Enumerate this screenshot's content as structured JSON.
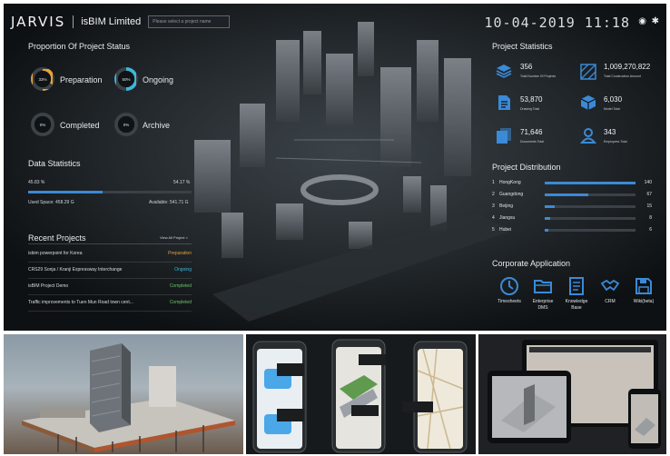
{
  "header": {
    "logo": "JARVIS",
    "company": "isBIM Limited",
    "search_placeholder": "Please select a project name",
    "clock": "10-04-2019 11:18"
  },
  "project_status": {
    "title": "Proportion Of Project Status",
    "items": [
      {
        "pct": "33%",
        "label": "Preparation",
        "value": 33,
        "color": "#e8a23a"
      },
      {
        "pct": "50%",
        "label": "Ongoing",
        "value": 50,
        "color": "#3fb6d8"
      },
      {
        "pct": "0%",
        "label": "Completed",
        "value": 0,
        "color": "#6ec36b"
      },
      {
        "pct": "0%",
        "label": "Archive",
        "value": 0,
        "color": "#9aa3ab"
      }
    ]
  },
  "data_statistics": {
    "title": "Data Statistics",
    "used_pct": "45.83 %",
    "available_pct": "54.17 %",
    "used_fraction": 0.4583,
    "used_space": "Used Space: 458.29 G",
    "available": "Available: 541.71 G"
  },
  "recent_projects": {
    "title": "Recent Projects",
    "view_all": "View All Project >",
    "rows": [
      {
        "name": "isbim powerpoint for Korea",
        "status": "Preparation",
        "color": "#e8a23a"
      },
      {
        "name": "CRS29 Sonja / Kranji Expressway Interchange",
        "status": "Ongoing",
        "color": "#3fb6d8"
      },
      {
        "name": "isBIM Project Demo",
        "status": "Completed",
        "color": "#6ec36b"
      },
      {
        "name": "Traffic improvements to Tuen Mun Road town cent...",
        "status": "Completed",
        "color": "#6ec36b"
      }
    ]
  },
  "project_statistics": {
    "title": "Project Statistics",
    "items": [
      {
        "value": "356",
        "label": "Total Number Of Projects",
        "icon": "cube-stack-icon"
      },
      {
        "value": "1,009,270,822",
        "label": "Total Construction Amount",
        "icon": "area-hatch-icon"
      },
      {
        "value": "53,870",
        "label": "Drawing Total",
        "icon": "drawing-doc-icon"
      },
      {
        "value": "6,030",
        "label": "Model Total",
        "icon": "model-cube-icon"
      },
      {
        "value": "71,646",
        "label": "Documents Total",
        "icon": "documents-icon"
      },
      {
        "value": "343",
        "label": "Employees Total",
        "icon": "user-icon"
      }
    ]
  },
  "project_distribution": {
    "title": "Project Distribution",
    "max": 140,
    "rows": [
      {
        "rank": "1",
        "name": "HongKong",
        "value": 140
      },
      {
        "rank": "2",
        "name": "Guangdong",
        "value": 67
      },
      {
        "rank": "3",
        "name": "Beijing",
        "value": 15
      },
      {
        "rank": "4",
        "name": "Jiangsu",
        "value": 8
      },
      {
        "rank": "5",
        "name": "Hubei",
        "value": 6
      }
    ]
  },
  "corporate_apps": {
    "title": "Corporate Application",
    "apps": [
      {
        "label": "Timesheets",
        "icon": "clock-icon"
      },
      {
        "label": "Enterprise DMS",
        "icon": "folder-icon"
      },
      {
        "label": "Knowledge Base",
        "icon": "book-icon"
      },
      {
        "label": "CRM",
        "icon": "handshake-icon"
      },
      {
        "label": "Wiki(beta)",
        "icon": "save-disk-icon"
      }
    ]
  },
  "colors": {
    "accent": "#3b8ad6",
    "background": "#101316"
  }
}
